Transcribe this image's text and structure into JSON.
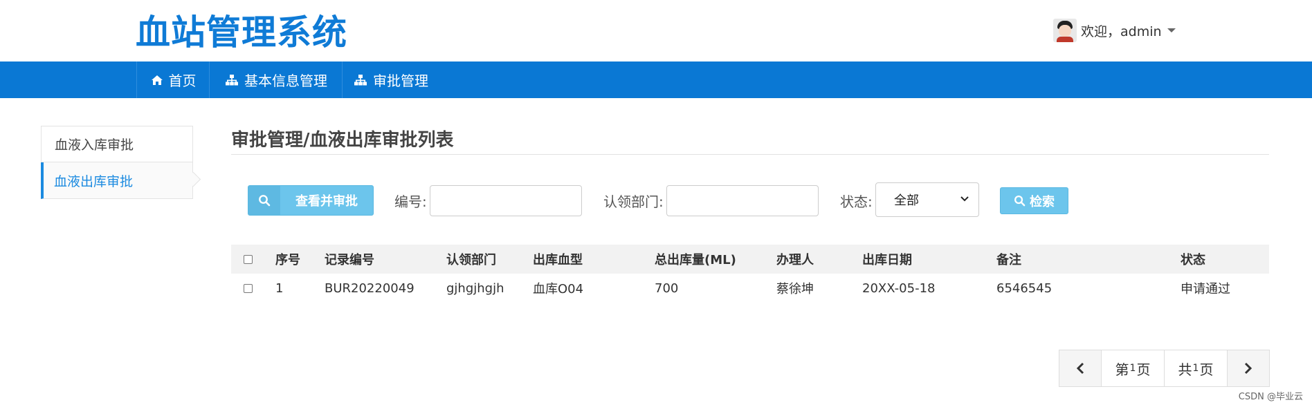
{
  "header": {
    "app_title": "血站管理系统",
    "welcome_text": "欢迎，admin"
  },
  "nav": {
    "items": [
      {
        "label": "首页",
        "icon": "home-icon"
      },
      {
        "label": "基本信息管理",
        "icon": "sitemap-icon"
      },
      {
        "label": "审批管理",
        "icon": "sitemap-icon"
      }
    ]
  },
  "sidebar": {
    "items": [
      {
        "label": "血液入库审批",
        "active": false
      },
      {
        "label": "血液出库审批",
        "active": true
      }
    ]
  },
  "main": {
    "page_title": "审批管理/血液出库审批列表",
    "approve_button": "查看并审批",
    "filters": {
      "code_label": "编号:",
      "code_value": "",
      "dept_label": "认领部门:",
      "dept_value": "",
      "status_label": "状态:",
      "status_selected": "全部"
    },
    "search_button": "检索"
  },
  "table": {
    "columns": [
      "序号",
      "记录编号",
      "认领部门",
      "出库血型",
      "总出库量(ML)",
      "办理人",
      "出库日期",
      "备注",
      "状态"
    ],
    "rows": [
      [
        "1",
        "BUR20220049",
        "gjhgjhgjh",
        "血库O04",
        "700",
        "蔡徐坤",
        "20XX-05-18",
        "6546545",
        "申请通过"
      ]
    ]
  },
  "pagination": {
    "page_prefix": "第",
    "page_number": "1",
    "page_suffix": "页",
    "total_prefix": "共",
    "total_number": "1",
    "total_suffix": "页"
  },
  "watermark": "CSDN @毕业云",
  "colors": {
    "brand": "#0a78d4",
    "title": "#0f7bd6",
    "button": "#6cc5ec"
  }
}
